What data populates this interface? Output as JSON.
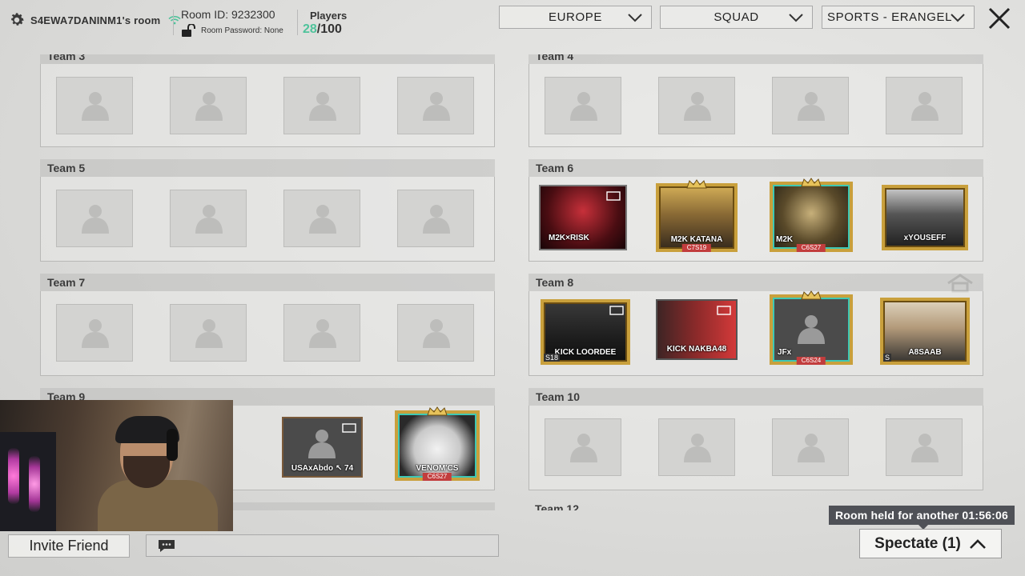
{
  "header": {
    "room_name": "S4EWA7DANINM1's room",
    "room_id": "Room ID: 9232300",
    "room_password": "Room Password: None",
    "players_label": "Players",
    "players_current": "28",
    "players_max": "/100"
  },
  "filters": {
    "region": "EUROPE",
    "mode": "SQUAD",
    "map": "SPORTS - ERANGEL"
  },
  "teams": [
    {
      "label": "Team 3"
    },
    {
      "label": "Team 4"
    },
    {
      "label": "Team 5"
    },
    {
      "label": "Team 6",
      "players": [
        {
          "name": "M2K×RISK"
        },
        {
          "name": "M2K KATANA",
          "tag": "C7S19"
        },
        {
          "name": "M2K",
          "tag": "C6S27"
        },
        {
          "name": "xYOUSEFF"
        }
      ]
    },
    {
      "label": "Team 7"
    },
    {
      "label": "Team 8",
      "players": [
        {
          "name": "KICK LOORDEE",
          "badge": "S18"
        },
        {
          "name": "KICK NAKBA48"
        },
        {
          "name": "JFx",
          "tag": "C6S24"
        },
        {
          "name": "A8SAAB",
          "badge": "S"
        }
      ]
    },
    {
      "label": "Team 9",
      "players": [
        {
          "name": "USAxAbdo ↖ 74"
        },
        {
          "name": "VENOM'CS",
          "tag": "C6S27"
        }
      ]
    },
    {
      "label": "Team 10"
    },
    {
      "label": "Team 12"
    }
  ],
  "footer": {
    "invite_label": "Invite Friend",
    "room_held": "Room held for another 01:56:06",
    "spectate_label": "Spectate (1)"
  },
  "colors": {
    "accent_green": "#4fc39b",
    "gold_frame": "#c9a03c",
    "tooltip_bg": "#4f5157"
  }
}
